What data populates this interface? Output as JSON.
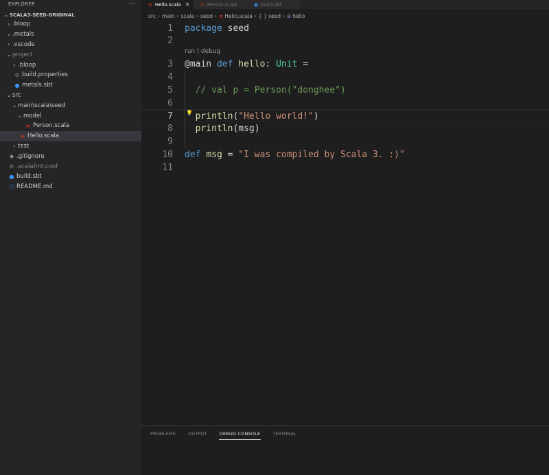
{
  "sidebar": {
    "header": "EXPLORER",
    "more": "···",
    "project": "SCALA3-SEED-ORIGINAL",
    "items": [
      {
        "label": ".bloop",
        "chev": "›",
        "icon": "",
        "level": 1,
        "dim": false
      },
      {
        "label": ".metals",
        "chev": "›",
        "icon": "",
        "level": 1,
        "dim": false
      },
      {
        "label": ".vscode",
        "chev": "›",
        "icon": "",
        "level": 1,
        "dim": false
      },
      {
        "label": "project",
        "chev": "⌄",
        "icon": "",
        "level": 1,
        "dim": true
      },
      {
        "label": ".bloop",
        "chev": "›",
        "icon": "",
        "level": 2,
        "dim": false
      },
      {
        "label": "build.properties",
        "chev": "",
        "icon": "gear-icon",
        "level": 2,
        "dim": false
      },
      {
        "label": "metals.sbt",
        "chev": "",
        "icon": "sbt-icon",
        "level": 2,
        "dim": false
      },
      {
        "label": "src",
        "chev": "⌄",
        "icon": "",
        "level": 1,
        "dim": false
      },
      {
        "label": "main\\scala\\seed",
        "chev": "⌄",
        "icon": "",
        "level": 2,
        "dim": false
      },
      {
        "label": "model",
        "chev": "⌄",
        "icon": "",
        "level": 3,
        "dim": false
      },
      {
        "label": "Person.scala",
        "chev": "",
        "icon": "scala-icon",
        "level": 4,
        "dim": false
      },
      {
        "label": "Hello.scala",
        "chev": "",
        "icon": "scala-icon",
        "level": 3,
        "dim": false,
        "selected": true
      },
      {
        "label": "test",
        "chev": "›",
        "icon": "",
        "level": 2,
        "dim": false
      },
      {
        "label": ".gitignore",
        "chev": "",
        "icon": "dot-icon",
        "level": 1,
        "dim": false
      },
      {
        "label": ".scalafmt.conf",
        "chev": "",
        "icon": "gear-icon",
        "level": 1,
        "dim": true
      },
      {
        "label": "build.sbt",
        "chev": "",
        "icon": "sbt-icon",
        "level": 1,
        "dim": false
      },
      {
        "label": "README.md",
        "chev": "",
        "icon": "info-icon",
        "level": 1,
        "dim": false
      }
    ]
  },
  "tabs": [
    {
      "label": "Hello.scala",
      "icon": "scala-icon",
      "active": true,
      "close": "✕"
    },
    {
      "label": "Person.scala",
      "icon": "scala-icon",
      "active": false
    },
    {
      "label": "build.sbt",
      "icon": "sbt-icon",
      "active": false
    }
  ],
  "breadcrumb": [
    "src",
    "main",
    "scala",
    "seed",
    "Hello.scala",
    "{ } seed",
    "hello"
  ],
  "editor": {
    "codelens": "run | debug",
    "active_line": 7,
    "lines": [
      {
        "n": "1",
        "tokens": [
          [
            "kw",
            "package"
          ],
          [
            "plain",
            " seed"
          ]
        ]
      },
      {
        "n": "2",
        "tokens": []
      },
      {
        "n": "3",
        "tokens": [
          [
            "plain",
            "@main "
          ],
          [
            "kw",
            "def"
          ],
          [
            "plain",
            " "
          ],
          [
            "fn",
            "hello"
          ],
          [
            "plain",
            ": "
          ],
          [
            "ty",
            "Unit"
          ],
          [
            "plain",
            " ="
          ]
        ]
      },
      {
        "n": "4",
        "tokens": []
      },
      {
        "n": "5",
        "tokens": [
          [
            "plain",
            "  "
          ],
          [
            "cm",
            "// val p = Person(\"donghee\")"
          ]
        ]
      },
      {
        "n": "6",
        "tokens": []
      },
      {
        "n": "7",
        "tokens": [
          [
            "plain",
            "  "
          ],
          [
            "fn",
            "println"
          ],
          [
            "plain",
            "("
          ],
          [
            "str",
            "\"Hello world!\""
          ],
          [
            "plain",
            ")"
          ]
        ]
      },
      {
        "n": "8",
        "tokens": [
          [
            "plain",
            "  "
          ],
          [
            "fn",
            "println"
          ],
          [
            "plain",
            "(msg)"
          ]
        ]
      },
      {
        "n": "9",
        "tokens": []
      },
      {
        "n": "10",
        "tokens": [
          [
            "kw",
            "def"
          ],
          [
            "plain",
            " "
          ],
          [
            "fn",
            "msg"
          ],
          [
            "plain",
            " = "
          ],
          [
            "str",
            "\"I was compiled by Scala 3. :)\""
          ]
        ]
      },
      {
        "n": "11",
        "tokens": []
      }
    ]
  },
  "panel": {
    "tabs": [
      "PROBLEMS",
      "OUTPUT",
      "DEBUG CONSOLE",
      "TERMINAL"
    ],
    "active": "DEBUG CONSOLE"
  },
  "colors": {
    "keyword": "#569cd6",
    "type": "#4ec9b0",
    "function": "#dcdcaa",
    "string": "#ce9178",
    "comment": "#6a9955",
    "scala_icon": "#de3423",
    "sbt_icon": "#3794ff"
  }
}
